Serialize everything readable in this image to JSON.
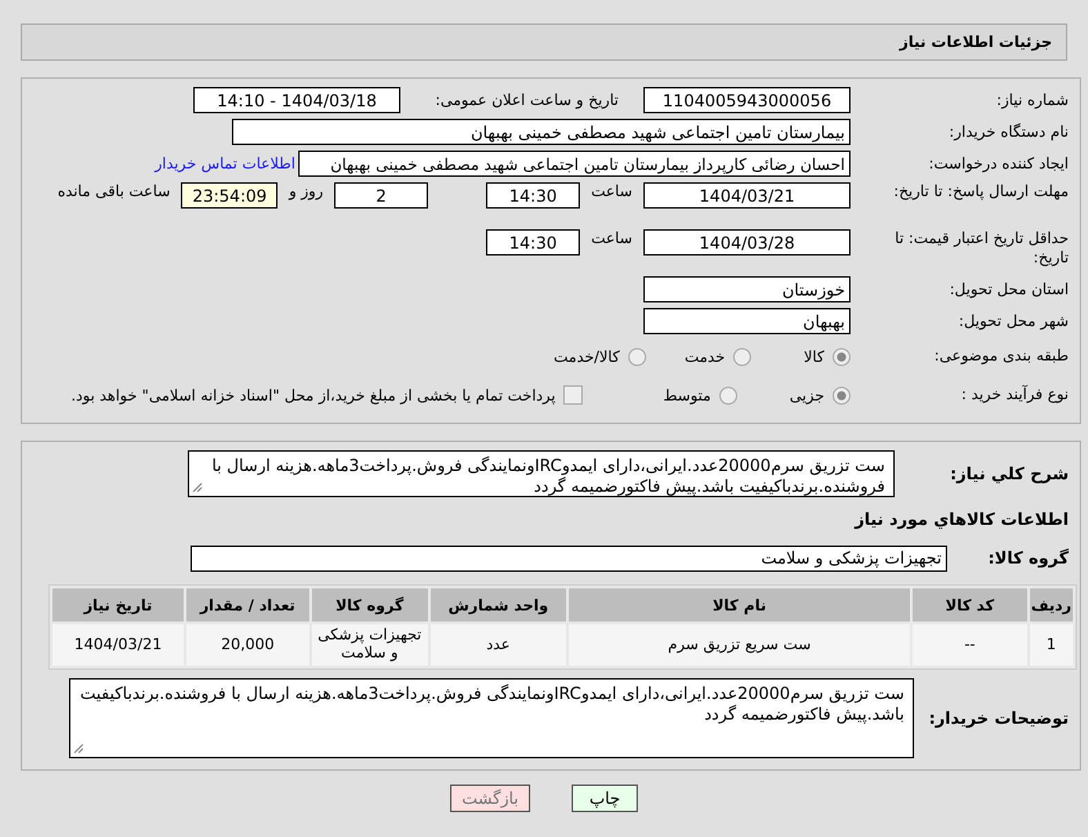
{
  "header": {
    "title": "جزئیات اطلاعات نیاز"
  },
  "details": {
    "need_number": {
      "label": "شماره نیاز:",
      "value": "1104005943000056"
    },
    "announce": {
      "label": "تاریخ و ساعت اعلان عمومی:",
      "value": "1404/03/18 - 14:10"
    },
    "buyer_org": {
      "label": "نام دستگاه خریدار:",
      "value": "بیمارستان تامین اجتماعی شهید مصطفی خمینی بهبهان"
    },
    "creator": {
      "label": "ایجاد کننده درخواست:",
      "value": "احسان رضائی کارپرداز بیمارستان تامین اجتماعی شهید مصطفی خمینی بهبهان",
      "link": "اطلاعات تماس خریدار"
    },
    "reply_deadline": {
      "label": "مهلت ارسال پاسخ: تا تاریخ:",
      "date": "1404/03/21",
      "time_label": "ساعت",
      "time": "14:30",
      "days": "2",
      "days_label": "روز و",
      "remaining": "23:54:09",
      "remaining_label": "ساعت باقی مانده"
    },
    "price_validity": {
      "label": "حداقل تاریخ اعتبار قیمت: تا تاریخ:",
      "date": "1404/03/28",
      "time_label": "ساعت",
      "time": "14:30"
    },
    "province": {
      "label": "استان محل تحویل:",
      "value": "خوزستان"
    },
    "city": {
      "label": "شهر محل تحویل:",
      "value": "بهبهان"
    },
    "category": {
      "label": "طبقه بندی موضوعی:",
      "options": [
        {
          "label": "کالا",
          "selected": true
        },
        {
          "label": "خدمت",
          "selected": false
        },
        {
          "label": "کالا/خدمت",
          "selected": false
        }
      ]
    },
    "process": {
      "label": "نوع فرآیند خرید :",
      "options": [
        {
          "label": "جزیی",
          "selected": true
        },
        {
          "label": "متوسط",
          "selected": false
        }
      ],
      "treasury": {
        "label": "پرداخت تمام یا بخشی از مبلغ خرید،از محل \"اسناد خزانه اسلامی\" خواهد بود.",
        "checked": false
      }
    }
  },
  "summary": {
    "label": "شرح کلي نياز:",
    "value": "ست تزریق سرم20000عدد.ایرانی،دارای ایمدوIRCونمایندگی فروش.پرداخت3ماهه.هزینه ارسال با فروشنده.برندباکیفیت باشد.پیش فاکتورضمیمه گردد"
  },
  "goods_heading": "اطلاعات كالاهاي مورد نياز",
  "goods_group": {
    "label": "گروه کالا:",
    "value": "تجهیزات پزشکی و سلامت"
  },
  "table": {
    "columns": [
      "ردیف",
      "کد کالا",
      "نام کالا",
      "واحد شمارش",
      "گروه کالا",
      "تعداد / مقدار",
      "تاریخ نیاز"
    ],
    "rows": [
      [
        "1",
        "--",
        "ست سریع تزریق سرم",
        "عدد",
        "تجهیزات پزشکی و سلامت",
        "20,000",
        "1404/03/21"
      ]
    ]
  },
  "buyer_notes": {
    "label": "توضیحات خریدار:",
    "value": "ست تزریق سرم20000عدد.ایرانی،دارای ایمدوIRCونمایندگی فروش.پرداخت3ماهه.هزینه ارسال با فروشنده.برندباکیفیت باشد.پیش فاکتورضمیمه گردد"
  },
  "buttons": [
    {
      "label": "چاپ",
      "kind": "print"
    },
    {
      "label": "بازگشت",
      "kind": "back"
    }
  ]
}
